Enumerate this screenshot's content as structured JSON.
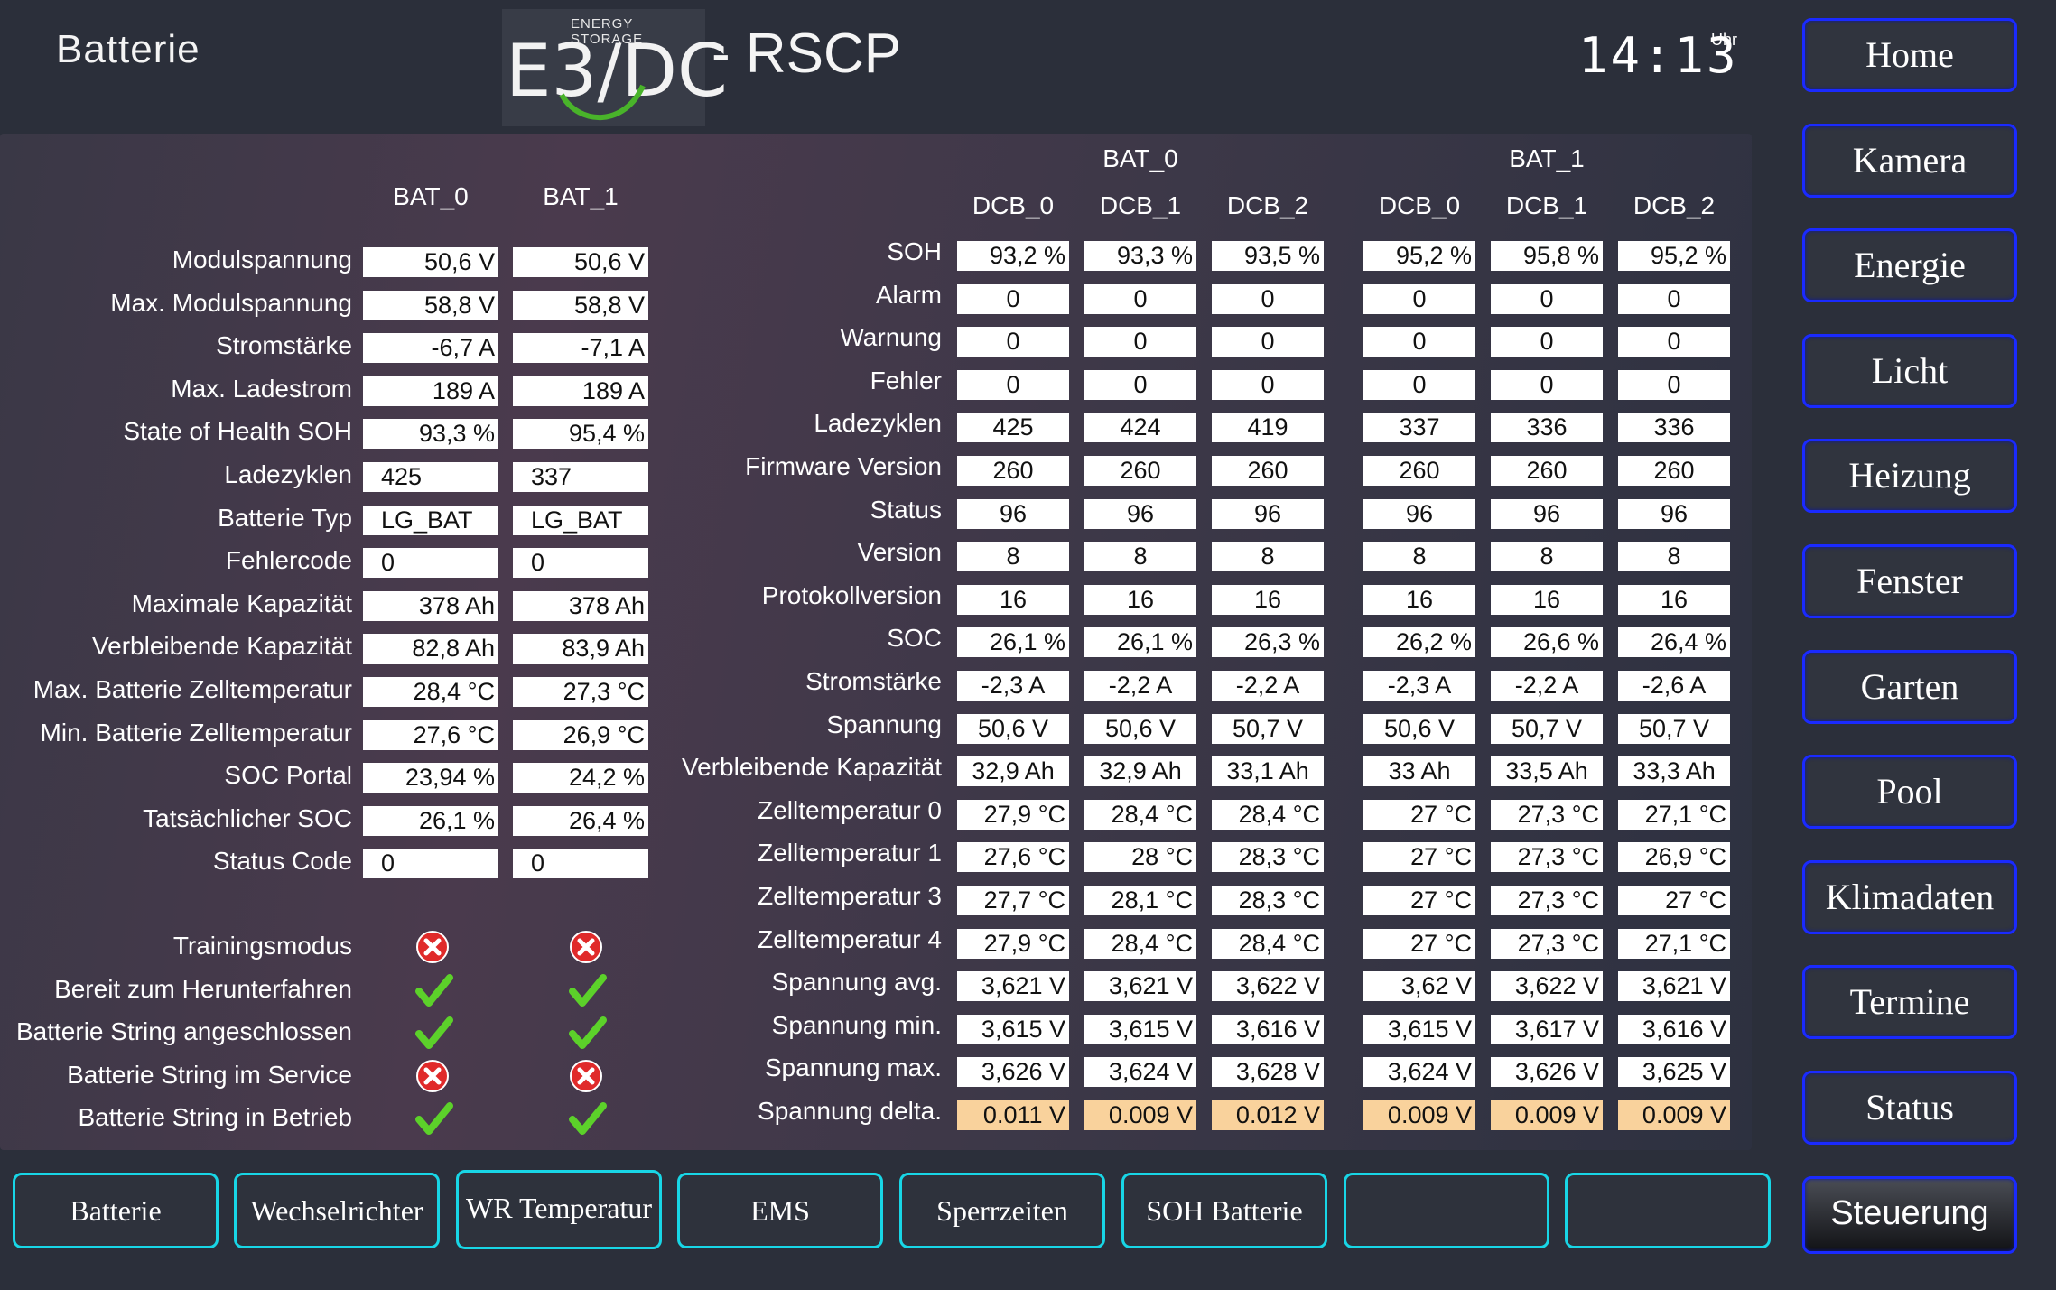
{
  "header": {
    "page_title": "Batterie",
    "logo_small": "ENERGY STORAGE",
    "logo_text": "E3/DC",
    "app_title": "- RSCP",
    "clock": "14:13",
    "clock_unit": "Uhr"
  },
  "left_table": {
    "columns": [
      "BAT_0",
      "BAT_1"
    ],
    "rows": [
      {
        "label": "Modulspannung",
        "values": [
          "50,6 V",
          "50,6 V"
        ]
      },
      {
        "label": "Max. Modulspannung",
        "values": [
          "58,8 V",
          "58,8 V"
        ]
      },
      {
        "label": "Stromstärke",
        "values": [
          "-6,7 A",
          "-7,1 A"
        ]
      },
      {
        "label": "Max. Ladestrom",
        "values": [
          "189 A",
          "189 A"
        ]
      },
      {
        "label": "State of Health SOH",
        "values": [
          "93,3 %",
          "95,4 %"
        ]
      },
      {
        "label": "Ladezyklen",
        "values": [
          "425",
          "337"
        ]
      },
      {
        "label": "Batterie Typ",
        "values": [
          "LG_BAT",
          "LG_BAT"
        ]
      },
      {
        "label": "Fehlercode",
        "values": [
          "0",
          "0"
        ]
      },
      {
        "label": "Maximale Kapazität",
        "values": [
          "378 Ah",
          "378 Ah"
        ]
      },
      {
        "label": "Verbleibende Kapazität",
        "values": [
          "82,8 Ah",
          "83,9 Ah"
        ]
      },
      {
        "label": "Max. Batterie Zelltemperatur",
        "values": [
          "28,4 °C",
          "27,3 °C"
        ]
      },
      {
        "label": "Min. Batterie Zelltemperatur",
        "values": [
          "27,6 °C",
          "26,9 °C"
        ]
      },
      {
        "label": "SOC Portal",
        "values": [
          "23,94 %",
          "24,2 %"
        ]
      },
      {
        "label": "Tatsächlicher SOC",
        "values": [
          "26,1 %",
          "26,4 %"
        ]
      },
      {
        "label": "Status Code",
        "values": [
          "0",
          "0"
        ]
      }
    ],
    "status_rows": [
      {
        "label": "Trainingsmodus",
        "values": [
          "cross-icon",
          "cross-icon"
        ]
      },
      {
        "label": "Bereit zum Herunterfahren",
        "values": [
          "check-icon",
          "check-icon"
        ]
      },
      {
        "label": "Batterie String angeschlossen",
        "values": [
          "check-icon",
          "check-icon"
        ]
      },
      {
        "label": "Batterie String im Service",
        "values": [
          "cross-icon",
          "cross-icon"
        ]
      },
      {
        "label": "Batterie String in Betrieb",
        "values": [
          "check-icon",
          "check-icon"
        ]
      }
    ]
  },
  "right_table": {
    "groups": [
      "BAT_0",
      "BAT_1"
    ],
    "columns": [
      "DCB_0",
      "DCB_1",
      "DCB_2",
      "DCB_0",
      "DCB_1",
      "DCB_2"
    ],
    "rows": [
      {
        "label": "SOH",
        "values": [
          "93,2 %",
          "93,3 %",
          "93,5 %",
          "95,2 %",
          "95,8 %",
          "95,2 %"
        ]
      },
      {
        "label": "Alarm",
        "values": [
          "0",
          "0",
          "0",
          "0",
          "0",
          "0"
        ]
      },
      {
        "label": "Warnung",
        "values": [
          "0",
          "0",
          "0",
          "0",
          "0",
          "0"
        ]
      },
      {
        "label": "Fehler",
        "values": [
          "0",
          "0",
          "0",
          "0",
          "0",
          "0"
        ]
      },
      {
        "label": "Ladezyklen",
        "values": [
          "425",
          "424",
          "419",
          "337",
          "336",
          "336"
        ]
      },
      {
        "label": "Firmware Version",
        "values": [
          "260",
          "260",
          "260",
          "260",
          "260",
          "260"
        ]
      },
      {
        "label": "Status",
        "values": [
          "96",
          "96",
          "96",
          "96",
          "96",
          "96"
        ]
      },
      {
        "label": "Version",
        "values": [
          "8",
          "8",
          "8",
          "8",
          "8",
          "8"
        ]
      },
      {
        "label": "Protokollversion",
        "values": [
          "16",
          "16",
          "16",
          "16",
          "16",
          "16"
        ]
      },
      {
        "label": "SOC",
        "values": [
          "26,1 %",
          "26,1 %",
          "26,3 %",
          "26,2 %",
          "26,6 %",
          "26,4 %"
        ]
      },
      {
        "label": "Stromstärke",
        "values": [
          "-2,3 A",
          "-2,2 A",
          "-2,2 A",
          "-2,3 A",
          "-2,2 A",
          "-2,6 A"
        ]
      },
      {
        "label": "Spannung",
        "values": [
          "50,6 V",
          "50,6 V",
          "50,7 V",
          "50,6 V",
          "50,7 V",
          "50,7 V"
        ]
      },
      {
        "label": "Verbleibende Kapazität",
        "values": [
          "32,9 Ah",
          "32,9 Ah",
          "33,1 Ah",
          "33 Ah",
          "33,5 Ah",
          "33,3 Ah"
        ]
      },
      {
        "label": "Zelltemperatur 0",
        "values": [
          "27,9 °C",
          "28,4 °C",
          "28,4 °C",
          "27 °C",
          "27,3 °C",
          "27,1 °C"
        ]
      },
      {
        "label": "Zelltemperatur 1",
        "values": [
          "27,6 °C",
          "28 °C",
          "28,3 °C",
          "27 °C",
          "27,3 °C",
          "26,9 °C"
        ]
      },
      {
        "label": "Zelltemperatur 3",
        "values": [
          "27,7 °C",
          "28,1 °C",
          "28,3 °C",
          "27 °C",
          "27,3 °C",
          "27 °C"
        ]
      },
      {
        "label": "Zelltemperatur 4",
        "values": [
          "27,9 °C",
          "28,4 °C",
          "28,4 °C",
          "27 °C",
          "27,3 °C",
          "27,1 °C"
        ]
      },
      {
        "label": "Spannung avg.",
        "values": [
          "3,621 V",
          "3,621 V",
          "3,622 V",
          "3,62 V",
          "3,622 V",
          "3,621 V"
        ]
      },
      {
        "label": "Spannung min.",
        "values": [
          "3,615 V",
          "3,615 V",
          "3,616 V",
          "3,615 V",
          "3,617 V",
          "3,616 V"
        ]
      },
      {
        "label": "Spannung max.",
        "values": [
          "3,626 V",
          "3,624 V",
          "3,628 V",
          "3,624 V",
          "3,626 V",
          "3,625 V"
        ]
      },
      {
        "label": "Spannung delta.",
        "values": [
          "0.011 V",
          "0.009 V",
          "0.012 V",
          "0.009 V",
          "0.009 V",
          "0.009 V"
        ],
        "highlight": true
      }
    ]
  },
  "nav": {
    "items": [
      "Home",
      "Kamera",
      "Energie",
      "Licht",
      "Heizung",
      "Fenster",
      "Garten",
      "Pool",
      "Klimadaten",
      "Termine",
      "Status",
      "Steuerung"
    ],
    "active": "Steuerung"
  },
  "tabs": {
    "items": [
      "Batterie",
      "Wechselrichter",
      "WR Temperatur",
      "EMS",
      "Sperrzeiten",
      "SOH Batterie",
      "",
      ""
    ]
  },
  "colors": {
    "background": "#2b2f3a",
    "nav_border": "#1a2aff",
    "tab_border": "#18d6e6",
    "highlight_cell": "#f9d29c",
    "check": "#5cd12a",
    "cross": "#e02a2a"
  }
}
